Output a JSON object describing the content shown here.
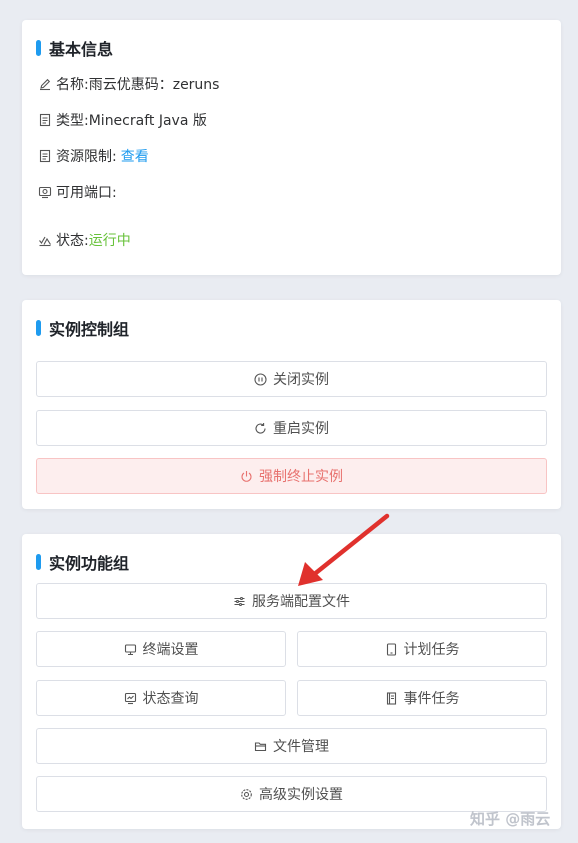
{
  "colors": {
    "accent_bar": "#1e9bef",
    "link": "#1e9bef",
    "status_running": "#67c23a",
    "danger_text": "#e8726f",
    "arrow": "#e0312d"
  },
  "basic_info": {
    "title": "基本信息",
    "name_label": "名称: ",
    "name_value": "雨云优惠码：zeruns",
    "type_label": "类型: ",
    "type_value": "Minecraft Java 版",
    "limit_label": "资源限制: ",
    "limit_link": "查看",
    "ports_label": "可用端口:",
    "status_label": "状态: ",
    "status_value": "运行中",
    "icons": [
      "pen-icon",
      "document-icon",
      "document-icon",
      "port-icon",
      "status-icon"
    ]
  },
  "control_group": {
    "title": "实例控制组",
    "close_label": "关闭实例",
    "restart_label": "重启实例",
    "kill_label": "强制终止实例"
  },
  "function_group": {
    "title": "实例功能组",
    "server_config_label": "服务端配置文件",
    "terminal_label": "终端设置",
    "schedule_label": "计划任务",
    "status_query_label": "状态查询",
    "event_label": "事件任务",
    "file_manager_label": "文件管理",
    "advanced_label": "高级实例设置"
  },
  "watermark": "知乎 @雨云"
}
